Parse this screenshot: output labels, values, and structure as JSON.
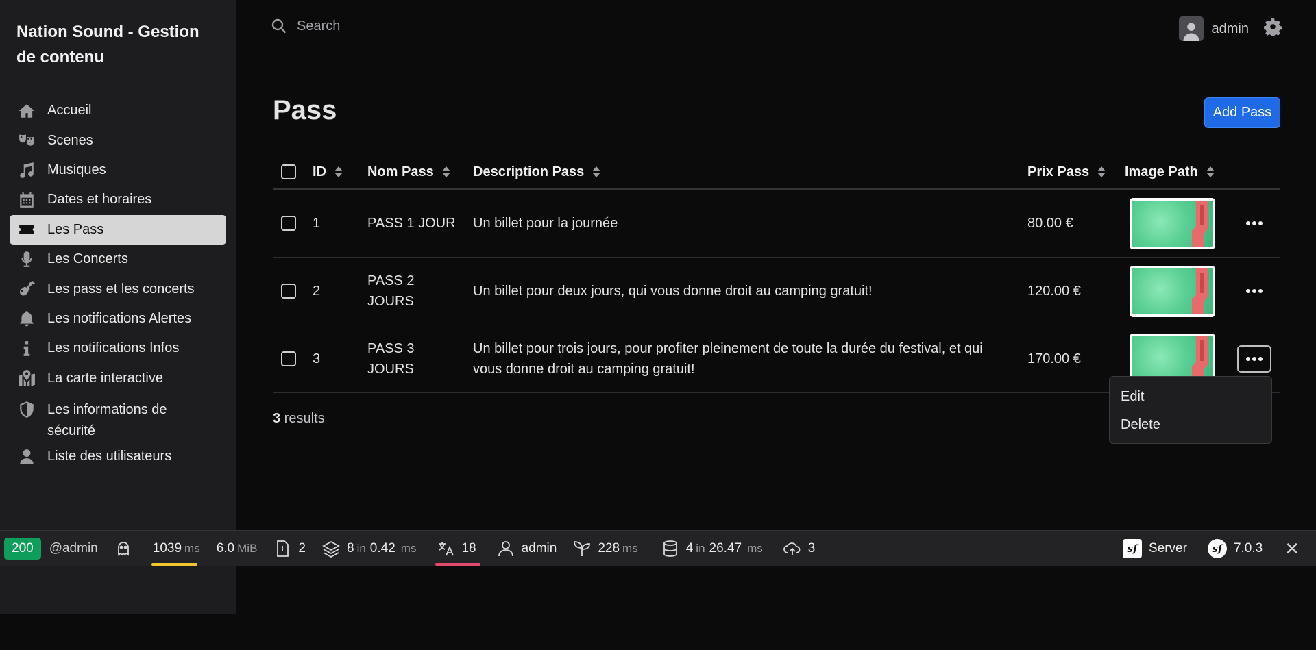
{
  "sidebar": {
    "brand": "Nation Sound - Gestion de contenu",
    "items": [
      {
        "label": "Accueil",
        "icon": "home-icon"
      },
      {
        "label": "Scenes",
        "icon": "theater-masks-icon"
      },
      {
        "label": "Musiques",
        "icon": "music-note-icon"
      },
      {
        "label": "Dates et horaires",
        "icon": "calendar-icon"
      },
      {
        "label": "Les Pass",
        "icon": "ticket-icon",
        "active": true
      },
      {
        "label": "Les Concerts",
        "icon": "microphone-icon"
      },
      {
        "label": "Les pass et les concerts",
        "icon": "guitar-icon"
      },
      {
        "label": "Les notifications Alertes",
        "icon": "bell-icon"
      },
      {
        "label": "Les notifications Infos",
        "icon": "info-icon"
      },
      {
        "label": "La carte interactive",
        "icon": "map-icon"
      },
      {
        "label": "Les informations de sécurité",
        "icon": "shield-icon"
      },
      {
        "label": "Liste des utilisateurs",
        "icon": "user-icon"
      }
    ]
  },
  "topbar": {
    "search_placeholder": "Search",
    "username": "admin"
  },
  "page": {
    "title": "Pass",
    "add_button": "Add Pass"
  },
  "table": {
    "headers": {
      "id": "ID",
      "nom": "Nom Pass",
      "description": "Description Pass",
      "prix": "Prix Pass",
      "image": "Image Path"
    },
    "rows": [
      {
        "id": "1",
        "nom": "PASS 1 JOUR",
        "description": "Un billet pour la journée",
        "prix": "80.00 €"
      },
      {
        "id": "2",
        "nom": "PASS 2 JOURS",
        "description": "Un billet pour deux jours, qui vous donne droit au camping gratuit!",
        "prix": "120.00 €"
      },
      {
        "id": "3",
        "nom": "PASS 3 JOURS",
        "description": "Un billet pour trois jours, pour profiter pleinement de toute la durée du festival, et qui vous donne droit au camping gratuit!",
        "prix": "170.00 €"
      }
    ],
    "results_count": "3",
    "results_label": " results"
  },
  "row_menu": {
    "edit": "Edit",
    "delete": "Delete"
  },
  "debug_toolbar": {
    "status_code": "200",
    "route": "@admin",
    "time": "1039",
    "time_unit": "ms",
    "memory": "6.0",
    "memory_unit": "MiB",
    "logs": "2",
    "cache_count": "8",
    "cache_in": "in",
    "cache_time": "0.42",
    "cache_unit": "ms",
    "translations": "18",
    "user": "admin",
    "twig_time": "228",
    "twig_unit": "ms",
    "db_count": "4",
    "db_in": "in",
    "db_time": "26.47",
    "db_unit": "ms",
    "uploads": "3",
    "server_label": "Server",
    "symfony_version": "7.0.3"
  },
  "colors": {
    "accent": "#1f6ae6",
    "status_ok": "#0f9d5b",
    "active_nav": "#d6d6d6",
    "time_bar": "#f4c531",
    "translation_bar": "#e24a6b"
  }
}
